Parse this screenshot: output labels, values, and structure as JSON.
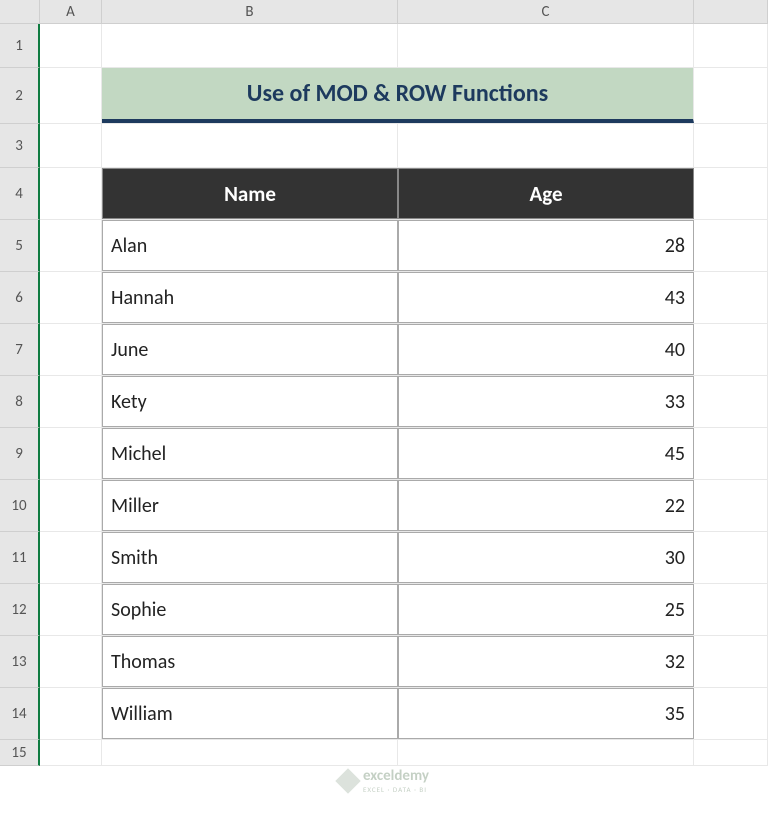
{
  "columns": [
    "A",
    "B",
    "C"
  ],
  "rows": [
    "1",
    "2",
    "3",
    "4",
    "5",
    "6",
    "7",
    "8",
    "9",
    "10",
    "11",
    "12",
    "13",
    "14",
    "15"
  ],
  "title": "Use of MOD & ROW Functions",
  "table": {
    "headers": {
      "name": "Name",
      "age": "Age"
    },
    "data": [
      {
        "name": "Alan",
        "age": "28"
      },
      {
        "name": "Hannah",
        "age": "43"
      },
      {
        "name": "June",
        "age": "40"
      },
      {
        "name": "Kety",
        "age": "33"
      },
      {
        "name": "Michel",
        "age": "45"
      },
      {
        "name": "Miller",
        "age": "22"
      },
      {
        "name": "Smith",
        "age": "30"
      },
      {
        "name": "Sophie",
        "age": "25"
      },
      {
        "name": "Thomas",
        "age": "32"
      },
      {
        "name": "William",
        "age": "35"
      }
    ]
  },
  "watermark": {
    "name": "exceldemy",
    "sub": "EXCEL · DATA · BI"
  }
}
